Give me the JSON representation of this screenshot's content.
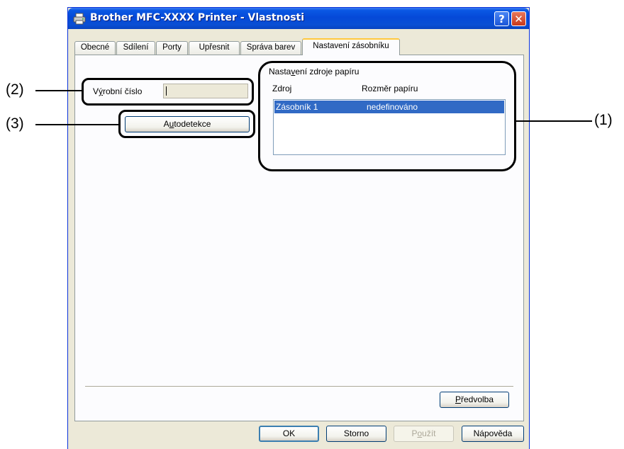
{
  "window": {
    "title": "Brother MFC-XXXX Printer - Vlastnosti",
    "help_label": "?",
    "close_label": "✕"
  },
  "tabs": [
    {
      "label": "Obecné"
    },
    {
      "label": "Sdílení"
    },
    {
      "label": "Porty"
    },
    {
      "label": "Upřesnit"
    },
    {
      "label": "Správa barev"
    },
    {
      "label": "Nastavení zásobníku",
      "active": true
    }
  ],
  "serial": {
    "label_pre": "V",
    "label_key": "ý",
    "label_post": "robní číslo",
    "value": ""
  },
  "autodetect": {
    "label_pre": "A",
    "label_key": "u",
    "label_post": "todetekce"
  },
  "paper_source": {
    "group_label_pre": "Nasta",
    "group_label_key": "v",
    "group_label_post": "ení zdroje papíru",
    "columns": [
      "Zdroj",
      "Rozměr papíru"
    ],
    "rows": [
      {
        "source": "Zásobník 1",
        "size": "nedefinováno",
        "selected": true
      }
    ]
  },
  "defaults_button": {
    "label_key": "P",
    "label_post": "ředvolba"
  },
  "footer": {
    "ok": "OK",
    "cancel": "Storno",
    "apply_pre": "P",
    "apply_key": "o",
    "apply_post": "užít",
    "help": "Nápověda"
  },
  "callouts": {
    "one": "(1)",
    "two": "(2)",
    "three": "(3)"
  },
  "colors": {
    "titlebar": "#0549d8",
    "selection": "#316ac5",
    "active_tab_accent": "#ffc83c"
  }
}
